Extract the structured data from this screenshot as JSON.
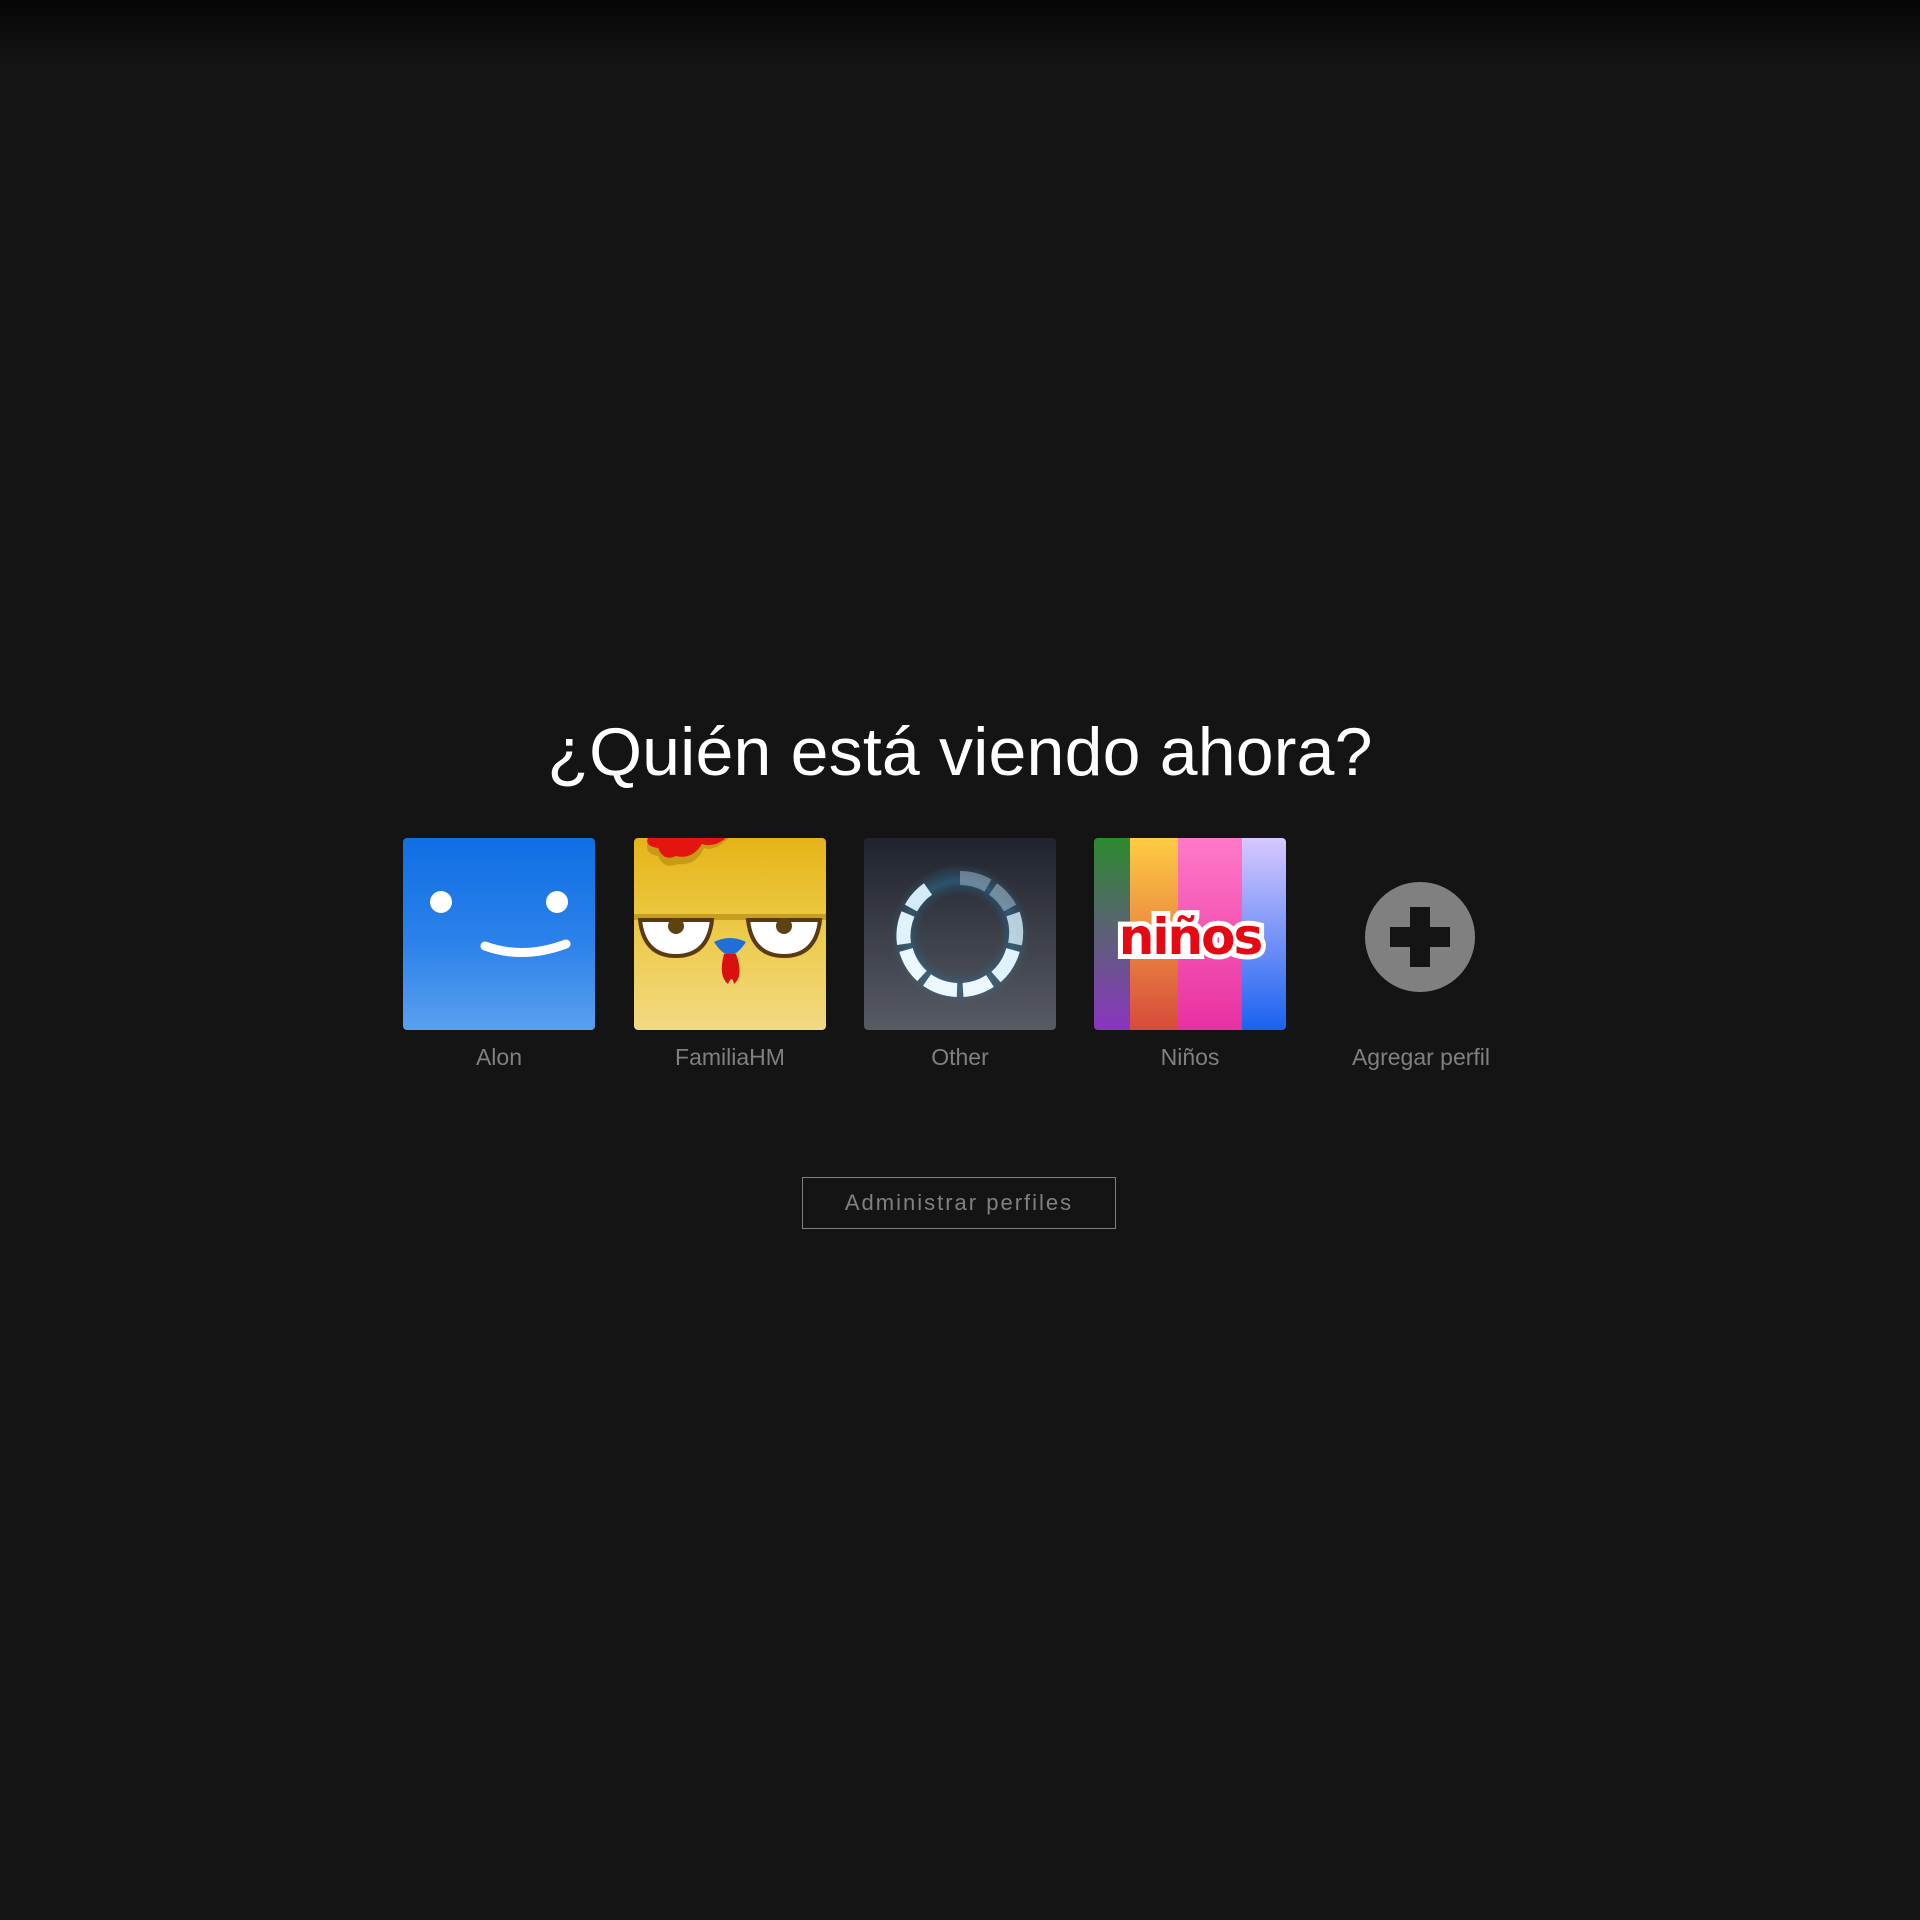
{
  "page": {
    "title": "¿Quién está viendo ahora?"
  },
  "profiles": [
    {
      "name": "Alon",
      "avatar_icon": "smiley-face-icon",
      "color": "#1474e3"
    },
    {
      "name": "FamiliaHM",
      "avatar_icon": "chicken-face-icon",
      "color": "#e8b818"
    },
    {
      "name": "Other",
      "avatar_icon": "loading-ring-icon",
      "color": "#2a2f3a"
    },
    {
      "name": "Niños",
      "avatar_icon": "kids-stripes-icon",
      "avatar_text": "niños",
      "color": "#e50914"
    },
    {
      "name": "Agregar perfil",
      "avatar_icon": "add-plus-icon",
      "color": "#808080"
    }
  ],
  "manage": {
    "label": "Administrar perfiles"
  },
  "colors": {
    "background": "#141414",
    "title": "#ffffff",
    "muted": "#808080"
  }
}
